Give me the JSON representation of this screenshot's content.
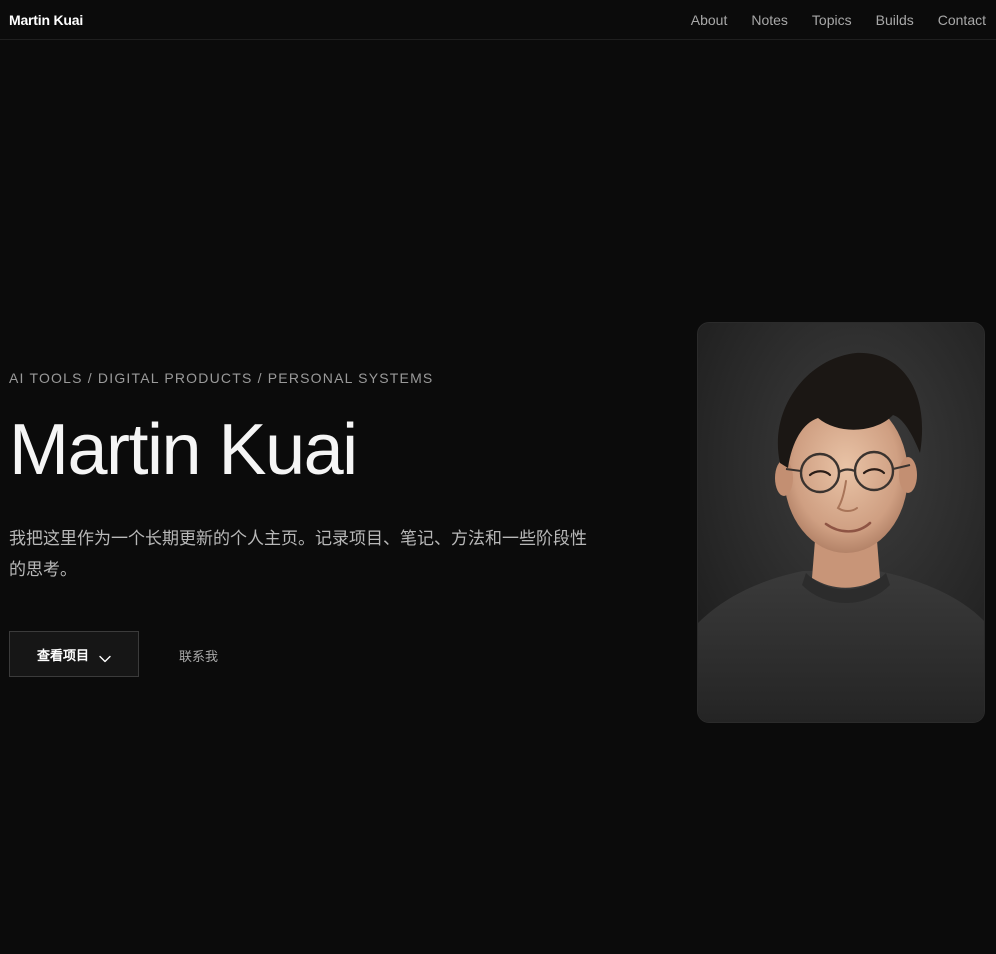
{
  "header": {
    "brand": "Martin Kuai",
    "nav": [
      {
        "label": "About"
      },
      {
        "label": "Notes"
      },
      {
        "label": "Topics"
      },
      {
        "label": "Builds"
      },
      {
        "label": "Contact"
      }
    ]
  },
  "hero": {
    "eyebrow": "AI TOOLS / DIGITAL PRODUCTS / PERSONAL SYSTEMS",
    "title": "Martin Kuai",
    "description": "我把这里作为一个长期更新的个人主页。记录项目、笔记、方法和一些阶段性的思考。",
    "primary_button": "查看项目",
    "secondary_link": "联系我"
  },
  "colors": {
    "background": "#0b0b0b",
    "text": "#ffffff",
    "muted": "#a8a8a8"
  },
  "icons": {
    "primary_button_icon": "chevron-down-icon"
  }
}
